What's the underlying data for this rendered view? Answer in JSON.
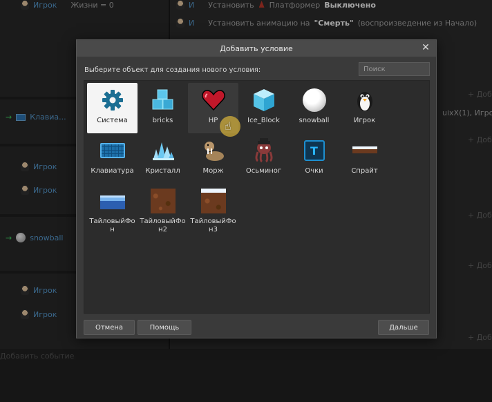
{
  "background": {
    "left_rows": [
      {
        "name": "Игрок",
        "extra": "Жизни = 0"
      },
      {
        "name": "Клавиа...",
        "extra": ""
      },
      {
        "name": "Игрок",
        "extra": ""
      },
      {
        "name": "Игрок",
        "extra": ""
      },
      {
        "name": "snowball",
        "extra": ""
      },
      {
        "name": "Игрок",
        "extra": ""
      },
      {
        "name": "Игрок",
        "extra": ""
      }
    ],
    "right_rows": [
      {
        "obj": "И",
        "text_plain": "Установить",
        "text_mid": "Платформер",
        "text_bold": "Выключено"
      },
      {
        "obj": "И",
        "text_plain": "Установить анимацию на",
        "text_bold": "\"Смерть\"",
        "text_tail": "(воспроизведение из Начало)"
      }
    ],
    "right_snippet": "uixX(1), Игрок.",
    "bottom_hint": "Добавить событие",
    "plus_label": "+ Доб"
  },
  "dialog": {
    "title": "Добавить условие",
    "prompt": "Выберите объект для создания нового условия:",
    "search_placeholder": "Поиск",
    "objects": [
      {
        "label": "Система",
        "icon": "gear-icon"
      },
      {
        "label": "bricks",
        "icon": "ice-cubes-icon"
      },
      {
        "label": "HP",
        "icon": "heart-icon"
      },
      {
        "label": "Ice_Block",
        "icon": "ice-block-icon"
      },
      {
        "label": "snowball",
        "icon": "snowball-icon"
      },
      {
        "label": "Игрок",
        "icon": "penguin-icon"
      },
      {
        "label": "Клавиатура",
        "icon": "keyboard-icon"
      },
      {
        "label": "Кристалл",
        "icon": "crystal-icon"
      },
      {
        "label": "Морж",
        "icon": "walrus-icon"
      },
      {
        "label": "Осьминог",
        "icon": "octopus-icon"
      },
      {
        "label": "Очки",
        "icon": "text-score-icon"
      },
      {
        "label": "Спрайт",
        "icon": "sprite-icon"
      },
      {
        "label": "ТайловыйФон",
        "icon": "tiled-bg-blue-icon"
      },
      {
        "label": "ТайловыйФон2",
        "icon": "tiled-bg-brown-icon"
      },
      {
        "label": "ТайловыйФон3",
        "icon": "tiled-bg-snow-icon"
      }
    ],
    "selected": "Система",
    "hovered": "HP",
    "buttons": {
      "cancel": "Отмена",
      "help": "Помощь",
      "next": "Дальше"
    }
  }
}
